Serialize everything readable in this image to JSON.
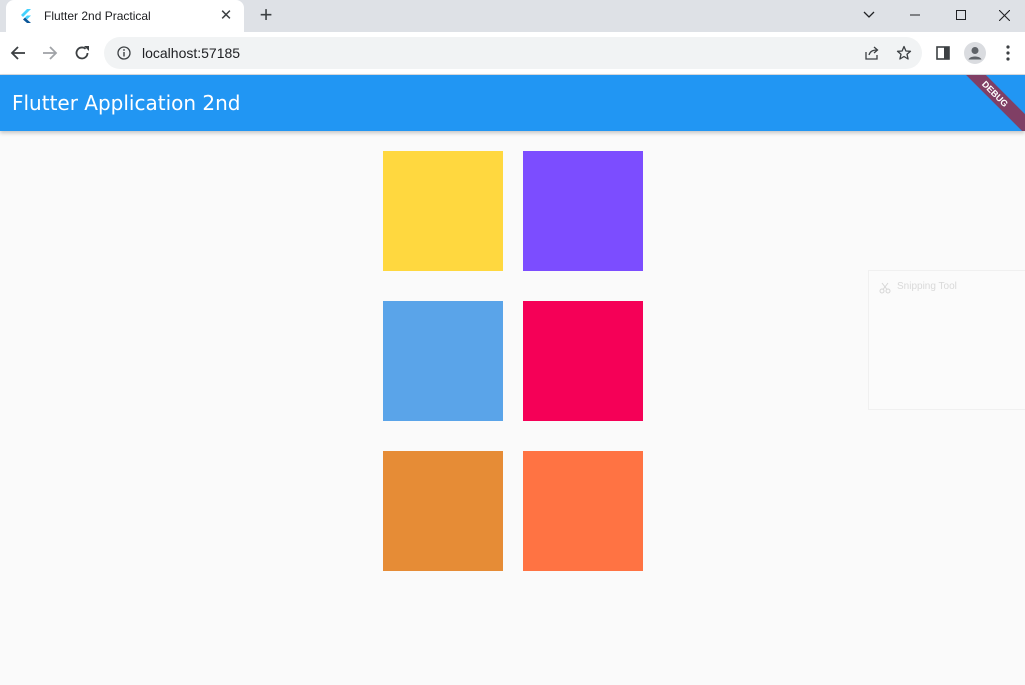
{
  "browser": {
    "tab_title": "Flutter 2nd Practical",
    "close_symbol": "✕",
    "new_tab_symbol": "+",
    "url": "localhost:57185"
  },
  "app": {
    "title": "Flutter Application 2nd",
    "debug_banner": "DEBUG",
    "appbar_color": "#2196f3"
  },
  "squares": [
    {
      "name": "yellow",
      "color": "#ffd83f"
    },
    {
      "name": "purple",
      "color": "#7c4dff"
    },
    {
      "name": "light-blue",
      "color": "#5aa4e9"
    },
    {
      "name": "pink-red",
      "color": "#f50057"
    },
    {
      "name": "orange",
      "color": "#e68c36"
    },
    {
      "name": "deep-orange",
      "color": "#ff7343"
    }
  ],
  "overlay": {
    "snipping_tool_label": "Snipping Tool"
  }
}
